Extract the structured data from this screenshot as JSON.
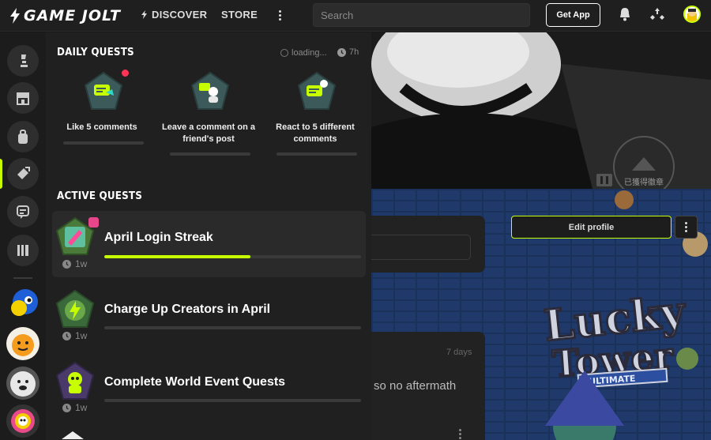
{
  "topbar": {
    "logo_text": "GAME JOLT",
    "nav": [
      {
        "label": "DISCOVER",
        "icon": "discover-bolt-icon"
      },
      {
        "label": "STORE"
      }
    ],
    "search_placeholder": "Search",
    "get_app_label": "Get App"
  },
  "quests_panel": {
    "daily_title": "DAILY QUESTS",
    "loading_text": "loading...",
    "timer_text": "7h",
    "daily_quests": [
      {
        "label": "Like 5 comments",
        "has_notification": true
      },
      {
        "label": "Leave a comment on a friend's post"
      },
      {
        "label": "React to 5 different comments"
      }
    ],
    "active_title": "ACTIVE QUESTS",
    "active_quests": [
      {
        "title": "April Login Streak",
        "time": "1w",
        "progress": 0.57,
        "highlighted": true,
        "has_gift": true
      },
      {
        "title": "Charge Up Creators in April",
        "time": "1w",
        "progress": 0
      },
      {
        "title": "Complete World Event Quests",
        "time": "1w",
        "progress": 0
      }
    ]
  },
  "background": {
    "post_age": "7 days",
    "post_snippet": "so no aftermath",
    "edit_profile_label": "Edit profile",
    "hero_badge_text": "已獲得徽章"
  },
  "colors": {
    "accent": "#c8ff00",
    "panel_bg": "#202020",
    "rail_bg": "#1c1c1c",
    "notification": "#ff3355"
  }
}
